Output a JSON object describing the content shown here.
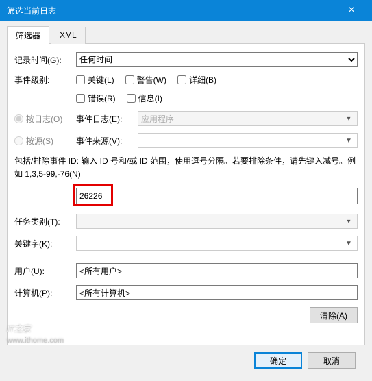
{
  "window": {
    "title": "筛选当前日志"
  },
  "tabs": {
    "filter": "筛选器",
    "xml": "XML"
  },
  "labels": {
    "logged": "记录时间(G):",
    "level": "事件级别:",
    "byLog": "按日志(O)",
    "bySource": "按源(S)",
    "eventLog": "事件日志(E):",
    "eventSource": "事件来源(V):",
    "help": "包括/排除事件 ID: 输入 ID 号和/或 ID 范围，使用逗号分隔。若要排除条件，请先键入减号。例如 1,3,5-99,-76(N)",
    "taskCategory": "任务类别(T):",
    "keywords": "关键字(K):",
    "user": "用户(U):",
    "computer": "计算机(P):"
  },
  "values": {
    "logged": "任何时间",
    "eventLog": "应用程序",
    "eventId": "26226",
    "user": "<所有用户>",
    "computer": "<所有计算机>"
  },
  "checkboxes": {
    "critical": "关键(L)",
    "warning": "警告(W)",
    "verbose": "详细(B)",
    "error": "错误(R)",
    "information": "信息(I)"
  },
  "buttons": {
    "clear": "清除(A)",
    "ok": "确定",
    "cancel": "取消"
  },
  "watermark": {
    "brand": "IT之家",
    "url": "www.ithome.com"
  }
}
